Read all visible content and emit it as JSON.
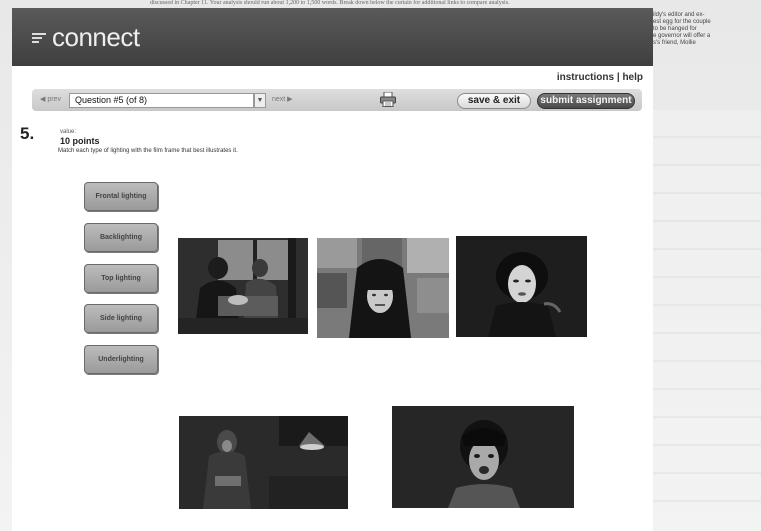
{
  "app": {
    "name": "connect"
  },
  "nav": {
    "instructions": "instructions",
    "separator": "|",
    "help": "help"
  },
  "toolbar": {
    "prev": "◀ prev",
    "question_select": "Question #5 (of 8)",
    "next": "next ▶",
    "save_exit": "save & exit",
    "submit": "submit assignment"
  },
  "question": {
    "number": "5.",
    "value_label": "value:",
    "points": "10 points",
    "instruction": "Match each type of lighting with the film frame that best illustrates it."
  },
  "lighting_options": [
    "Frontal lighting",
    "Backlighting",
    "Top lighting",
    "Side lighting",
    "Underlighting"
  ],
  "background_text": {
    "top_line": "discussed in Chapter 11. Your analysis should run about 1,200 to 1,500 words. Break down below the curtain for additional links to compare analysis.",
    "right_column": "ildy's editor and ex-\nest egg for the couple\nto be hanged for\ne governor will offer a\ns's friend, Mollie"
  },
  "icons": [
    "printer-icon",
    "dropdown-arrow-icon",
    "connect-logo-icon"
  ]
}
